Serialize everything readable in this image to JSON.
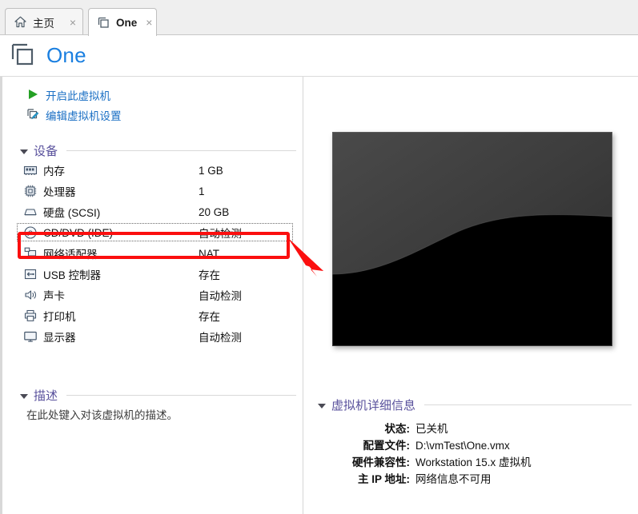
{
  "tabs": [
    {
      "label": "主页",
      "icon": "home-icon",
      "active": false,
      "close": "×"
    },
    {
      "label": "One",
      "icon": "vm-stack-icon",
      "active": true,
      "close": "×"
    }
  ],
  "header": {
    "title": "One",
    "icon": "vm-stack-icon",
    "title_color": "#1a7fe0"
  },
  "actions": [
    {
      "label": "开启此虚拟机",
      "icon": "play-icon"
    },
    {
      "label": "编辑虚拟机设置",
      "icon": "edit-settings-icon"
    }
  ],
  "devices_section": {
    "title": "设备",
    "expanded": true,
    "items": [
      {
        "name": "内存",
        "value": "1 GB",
        "icon": "memory-icon",
        "selected": false
      },
      {
        "name": "处理器",
        "value": "1",
        "icon": "processor-icon",
        "selected": false
      },
      {
        "name": "硬盘 (SCSI)",
        "value": "20 GB",
        "icon": "harddisk-icon",
        "selected": false
      },
      {
        "name": "CD/DVD (IDE)",
        "value": "自动检测",
        "icon": "cddvd-icon",
        "selected": true
      },
      {
        "name": "网络适配器",
        "value": "NAT",
        "icon": "network-icon",
        "selected": false
      },
      {
        "name": "USB 控制器",
        "value": "存在",
        "icon": "usb-icon",
        "selected": false
      },
      {
        "name": "声卡",
        "value": "自动检测",
        "icon": "sound-icon",
        "selected": false
      },
      {
        "name": "打印机",
        "value": "存在",
        "icon": "printer-icon",
        "selected": false
      },
      {
        "name": "显示器",
        "value": "自动检测",
        "icon": "display-icon",
        "selected": false
      }
    ]
  },
  "description_section": {
    "title": "描述",
    "expanded": true,
    "placeholder": "在此处键入对该虚拟机的描述。"
  },
  "details_section": {
    "title": "虚拟机详细信息",
    "expanded": true,
    "rows": [
      {
        "label": "状态:",
        "value": "已关机"
      },
      {
        "label": "配置文件:",
        "value": "D:\\vmTest\\One.vmx"
      },
      {
        "label": "硬件兼容性:",
        "value": "Workstation 15.x 虚拟机"
      },
      {
        "label": "主 IP 地址:",
        "value": "网络信息不可用"
      }
    ]
  },
  "thumbnail": {
    "name": "vm-preview-thumbnail",
    "top_color": "#434343",
    "bottom_color": "#000000"
  },
  "annotation": {
    "highlight_color": "#fb0f0f",
    "target": "CD/DVD (IDE)"
  }
}
